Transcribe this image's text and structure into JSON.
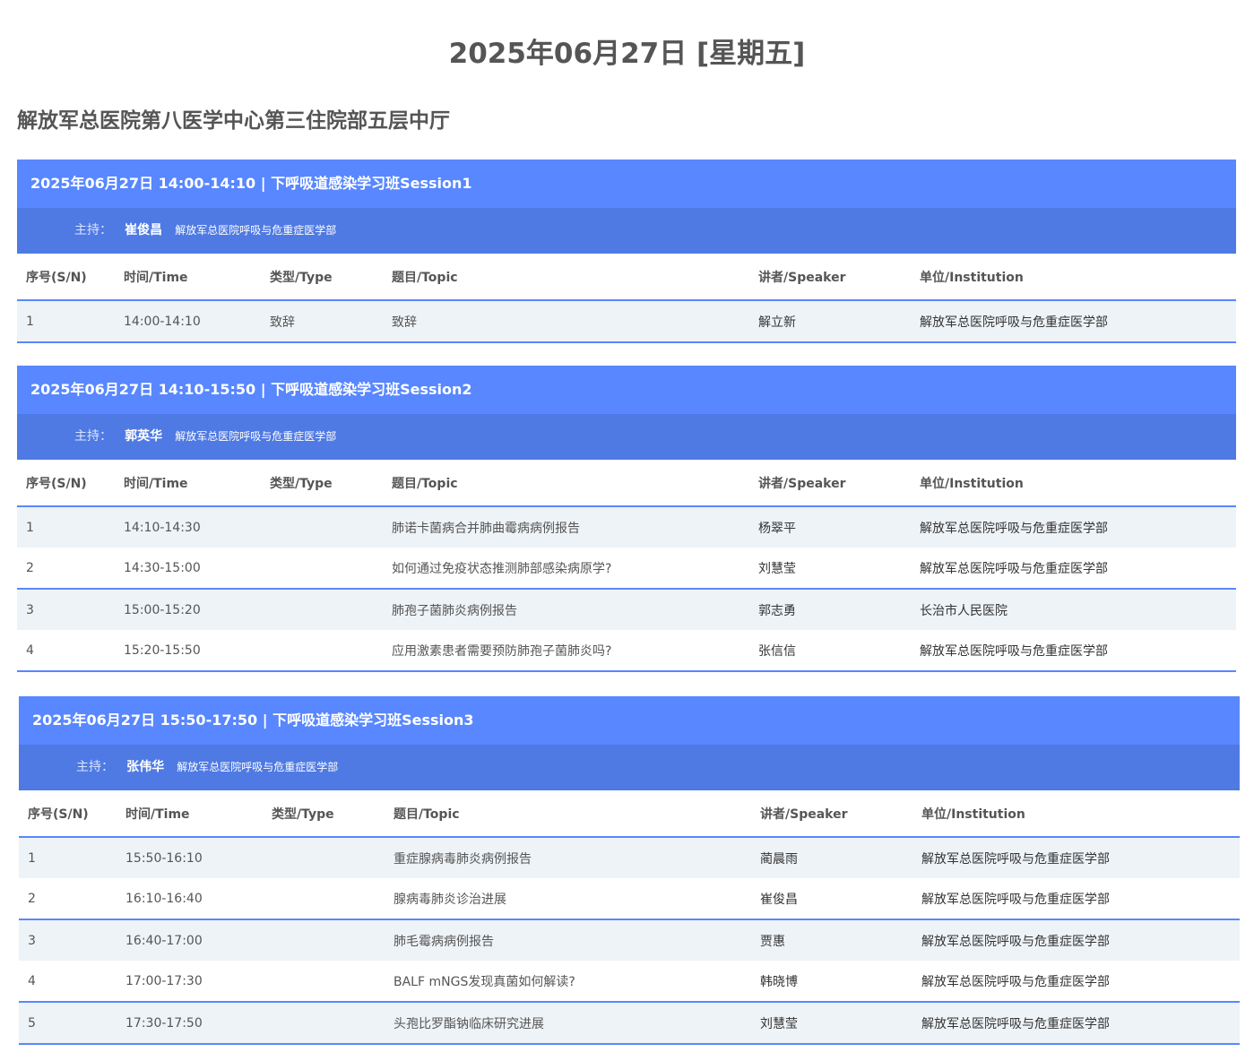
{
  "page": {
    "title": "2025年06月27日 [星期五]",
    "venue": "解放军总医院第八医学中心第三住院部五层中厅"
  },
  "columns": {
    "sn": "序号(S/N)",
    "time": "时间/Time",
    "type": "类型/Type",
    "topic": "题目/Topic",
    "speaker": "讲者/Speaker",
    "institution": "单位/Institution"
  },
  "host_label": "主持：",
  "sessions": [
    {
      "header": "2025年06月27日 14:00-14:10 | 下呼吸道感染学习班Session1",
      "host_name": "崔俊昌",
      "host_institution": "解放军总医院呼吸与危重症医学部",
      "rows": [
        {
          "sn": "1",
          "time": "14:00-14:10",
          "type": "致辞",
          "topic": "致辞",
          "speaker": "解立新",
          "institution": "解放军总医院呼吸与危重症医学部"
        }
      ]
    },
    {
      "header": "2025年06月27日 14:10-15:50 | 下呼吸道感染学习班Session2",
      "host_name": "郭英华",
      "host_institution": "解放军总医院呼吸与危重症医学部",
      "rows": [
        {
          "sn": "1",
          "time": "14:10-14:30",
          "type": "",
          "topic": "肺诺卡菌病合并肺曲霉病病例报告",
          "speaker": "杨翠平",
          "institution": "解放军总医院呼吸与危重症医学部"
        },
        {
          "sn": "2",
          "time": "14:30-15:00",
          "type": "",
          "topic": "如何通过免疫状态推测肺部感染病原学?",
          "speaker": "刘慧莹",
          "institution": "解放军总医院呼吸与危重症医学部"
        },
        {
          "sn": "3",
          "time": "15:00-15:20",
          "type": "",
          "topic": "肺孢子菌肺炎病例报告",
          "speaker": "郭志勇",
          "institution": "长治市人民医院"
        },
        {
          "sn": "4",
          "time": "15:20-15:50",
          "type": "",
          "topic": "应用激素患者需要预防肺孢子菌肺炎吗?",
          "speaker": "张信信",
          "institution": "解放军总医院呼吸与危重症医学部"
        }
      ]
    },
    {
      "header": "2025年06月27日 15:50-17:50 | 下呼吸道感染学习班Session3",
      "host_name": "张伟华",
      "host_institution": "解放军总医院呼吸与危重症医学部",
      "rows": [
        {
          "sn": "1",
          "time": "15:50-16:10",
          "type": "",
          "topic": "重症腺病毒肺炎病例报告",
          "speaker": "蔺晨雨",
          "institution": "解放军总医院呼吸与危重症医学部"
        },
        {
          "sn": "2",
          "time": "16:10-16:40",
          "type": "",
          "topic": "腺病毒肺炎诊治进展",
          "speaker": "崔俊昌",
          "institution": "解放军总医院呼吸与危重症医学部"
        },
        {
          "sn": "3",
          "time": "16:40-17:00",
          "type": "",
          "topic": "肺毛霉病病例报告",
          "speaker": "贾惠",
          "institution": "解放军总医院呼吸与危重症医学部"
        },
        {
          "sn": "4",
          "time": "17:00-17:30",
          "type": "",
          "topic": "BALF mNGS发现真菌如何解读?",
          "speaker": "韩晓博",
          "institution": "解放军总医院呼吸与危重症医学部"
        },
        {
          "sn": "5",
          "time": "17:30-17:50",
          "type": "",
          "topic": "头孢比罗酯钠临床研究进展",
          "speaker": "刘慧莹",
          "institution": "解放军总医院呼吸与危重症医学部"
        }
      ]
    }
  ]
}
